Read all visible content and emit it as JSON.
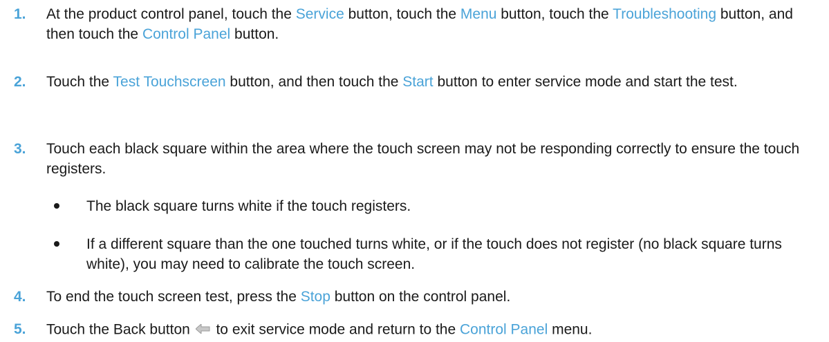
{
  "accent_color": "#4aa3d8",
  "steps": [
    {
      "number": "1.",
      "parts": [
        {
          "t": "At the product control panel, touch the "
        },
        {
          "t": "Service",
          "k": true
        },
        {
          "t": " button, touch the "
        },
        {
          "t": "Menu",
          "k": true
        },
        {
          "t": " button, touch the "
        },
        {
          "t": "Troubleshooting",
          "k": true
        },
        {
          "t": " button, and then touch the "
        },
        {
          "t": "Control Panel",
          "k": true
        },
        {
          "t": " button."
        }
      ]
    },
    {
      "number": "2.",
      "parts": [
        {
          "t": "Touch the "
        },
        {
          "t": "Test Touchscreen",
          "k": true
        },
        {
          "t": " button, and then touch the "
        },
        {
          "t": "Start",
          "k": true
        },
        {
          "t": " button to enter service mode and start the test."
        }
      ]
    },
    {
      "number": "3.",
      "parts": [
        {
          "t": "Touch each black square within the area where the touch screen may not be responding correctly to ensure the touch registers."
        }
      ]
    },
    {
      "number": "4.",
      "parts": [
        {
          "t": "To end the touch screen test, press the "
        },
        {
          "t": "Stop",
          "k": true
        },
        {
          "t": " button on the control panel."
        }
      ]
    },
    {
      "number": "5.",
      "parts": [
        {
          "t": "Touch the Back button "
        },
        {
          "icon": "back-arrow-icon"
        },
        {
          "t": " to exit service mode and return to the "
        },
        {
          "t": "Control Panel",
          "k": true
        },
        {
          "t": " menu."
        }
      ]
    }
  ],
  "bullets": [
    "The black square turns white if the touch registers.",
    "If a different square than the one touched turns white, or if the touch does not register (no black square turns white), you may need to calibrate the touch screen."
  ]
}
